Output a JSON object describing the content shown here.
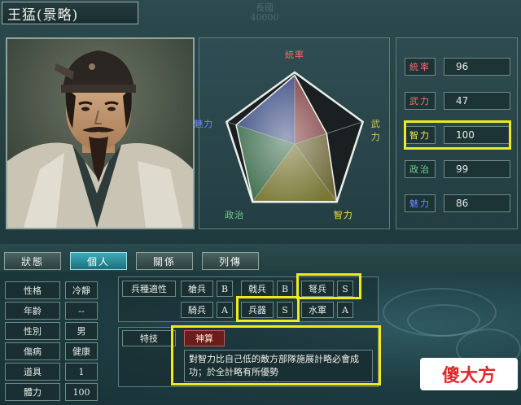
{
  "header": {
    "officer_name": "王猛(景略)",
    "faction_label": "長國",
    "faction_value": "40000"
  },
  "radar": {
    "axes": [
      "統率",
      "武力",
      "智力",
      "政治",
      "魅力"
    ],
    "axis_colors": [
      "#ff6b6b",
      "#d9c65a",
      "#e8e04a",
      "#6fd18a",
      "#6c8bff"
    ],
    "values": [
      96,
      47,
      100,
      99,
      86
    ],
    "max": 100
  },
  "stats": [
    {
      "label": "統率",
      "value": "96",
      "color": "#ff6b6b"
    },
    {
      "label": "武力",
      "value": "47",
      "color": "#ff6b6b"
    },
    {
      "label": "智力",
      "value": "100",
      "color": "#f2e94e"
    },
    {
      "label": "政治",
      "value": "99",
      "color": "#6fd18a"
    },
    {
      "label": "魅力",
      "value": "86",
      "color": "#6c8bff"
    }
  ],
  "tabs": [
    {
      "label": "狀態"
    },
    {
      "label": "個人"
    },
    {
      "label": "關係"
    },
    {
      "label": "列傳"
    }
  ],
  "personal": [
    {
      "label": "性格",
      "value": "冷靜"
    },
    {
      "label": "年齡",
      "value": "--"
    },
    {
      "label": "性別",
      "value": "男"
    },
    {
      "label": "傷病",
      "value": "健康"
    },
    {
      "label": "道具",
      "value": "1"
    },
    {
      "label": "體力",
      "value": "100"
    }
  ],
  "troops": {
    "title": "兵種適性",
    "row1": [
      {
        "name": "槍兵",
        "grade": "B"
      },
      {
        "name": "戟兵",
        "grade": "B"
      },
      {
        "name": "弩兵",
        "grade": "S"
      }
    ],
    "row2": [
      {
        "name": "騎兵",
        "grade": "A"
      },
      {
        "name": "兵器",
        "grade": "S"
      },
      {
        "name": "水軍",
        "grade": "A"
      }
    ]
  },
  "skill": {
    "title": "特技",
    "name": "神算",
    "description": "對智力比自己低的敵方部隊施展計略必會成功；於全計略有所優勢"
  },
  "watermark": "傻大方"
}
